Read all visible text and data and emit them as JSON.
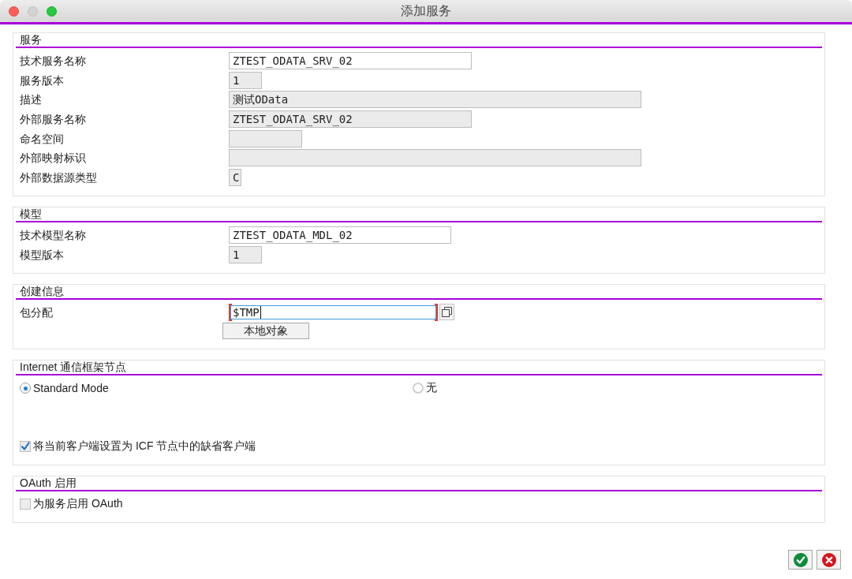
{
  "window": {
    "title": "添加服务",
    "controls": [
      {
        "kind": "close",
        "disabled": false
      },
      {
        "kind": "minimize",
        "disabled": true
      },
      {
        "kind": "zoom",
        "disabled": false
      }
    ]
  },
  "sections": [
    {
      "title": "服务",
      "rows": [
        {
          "label": "技术服务名称",
          "value": "ZTEST_ODATA_SRV_02",
          "editable": true,
          "focused": false,
          "value_help": false
        },
        {
          "label": "服务版本",
          "value": "1",
          "editable": false,
          "focused": false,
          "value_help": false
        },
        {
          "label": "描述",
          "value": "测试OData",
          "editable": false,
          "focused": false,
          "value_help": false
        },
        {
          "label": "外部服务名称",
          "value": "ZTEST_ODATA_SRV_02",
          "editable": false,
          "focused": false,
          "value_help": false
        },
        {
          "label": "命名空间",
          "editable": false,
          "focused": false,
          "value_help": false
        },
        {
          "label": "外部映射标识",
          "editable": false,
          "focused": false,
          "value_help": false
        },
        {
          "label": "外部数据源类型",
          "value": "C",
          "editable": false,
          "focused": false,
          "value_help": false
        }
      ]
    },
    {
      "title": "模型",
      "rows": [
        {
          "label": "技术模型名称",
          "value": "ZTEST_ODATA_MDL_02",
          "editable": true,
          "focused": false,
          "value_help": false
        },
        {
          "label": "模型版本",
          "value": "1",
          "editable": false,
          "focused": false,
          "value_help": false
        }
      ]
    },
    {
      "title": "创建信息",
      "rows": [
        {
          "label": "包分配",
          "value": "$TMP",
          "editable": true,
          "focused": true,
          "value_help": true
        }
      ],
      "buttons": [
        "本地对象"
      ]
    },
    {
      "title": "Internet 通信框架节点",
      "radios": [
        {
          "label": "Standard Mode",
          "selected": true
        },
        {
          "label": "无",
          "selected": false
        }
      ],
      "checkboxes": [
        {
          "label": "将当前客户端设置为 ICF 节点中的缺省客户端",
          "checked": true
        }
      ]
    },
    {
      "title": "OAuth 启用",
      "checkboxes": [
        {
          "label": "为服务启用 OAuth",
          "checked": false
        }
      ]
    }
  ],
  "footer_buttons": [
    {
      "kind": "confirm"
    },
    {
      "kind": "cancel"
    }
  ]
}
